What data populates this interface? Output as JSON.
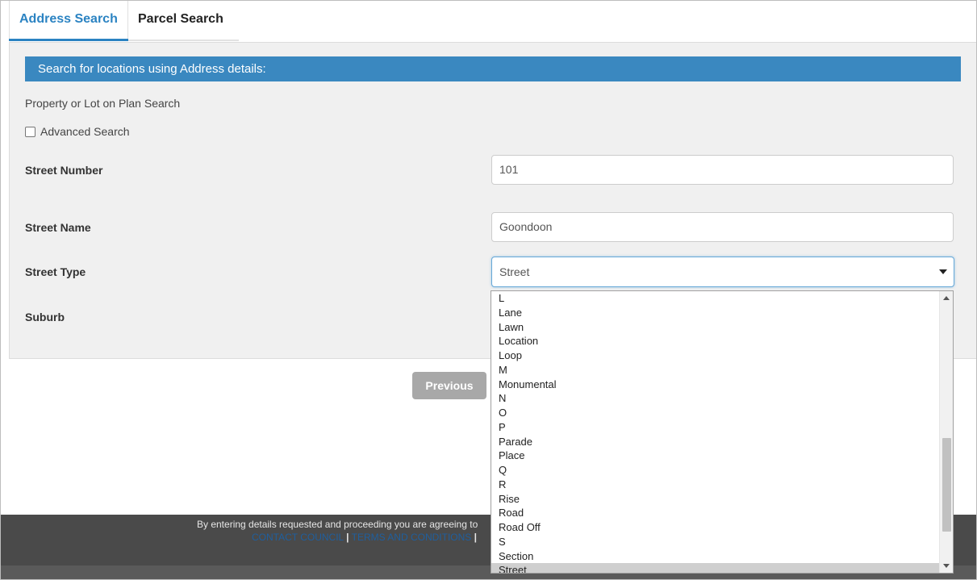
{
  "tabs": {
    "address_search": "Address Search",
    "parcel_search": "Parcel Search"
  },
  "panel": {
    "header": "Search for locations using Address details:",
    "subtext": "Property or Lot on Plan Search",
    "advanced_search_label": "Advanced Search",
    "advanced_search_checked": false
  },
  "fields": {
    "street_number": {
      "label": "Street Number",
      "value": "101"
    },
    "street_name": {
      "label": "Street Name",
      "value": "Goondoon"
    },
    "street_type": {
      "label": "Street Type",
      "value": "Street"
    },
    "suburb": {
      "label": "Suburb"
    }
  },
  "buttons": {
    "previous": "Previous"
  },
  "footer": {
    "text": "By entering details requested and proceeding you are agreeing to",
    "link_contact": "CONTACT COUNCIL",
    "separator": "|",
    "link_terms": "TERMS AND CONDITIONS"
  },
  "dropdown": {
    "options": [
      "L",
      "Lane",
      "Lawn",
      "Location",
      "Loop",
      "M",
      "Monumental",
      "N",
      "O",
      "P",
      "Parade",
      "Place",
      "Q",
      "R",
      "Rise",
      "Road",
      "Road Off",
      "S",
      "Section",
      "Street"
    ],
    "selected": "Street"
  },
  "colors": {
    "accent": "#2b83c2",
    "header_bg": "#3a88c0",
    "footer_bg": "#4a4a4a",
    "button_disabled": "#a8a8a8"
  }
}
